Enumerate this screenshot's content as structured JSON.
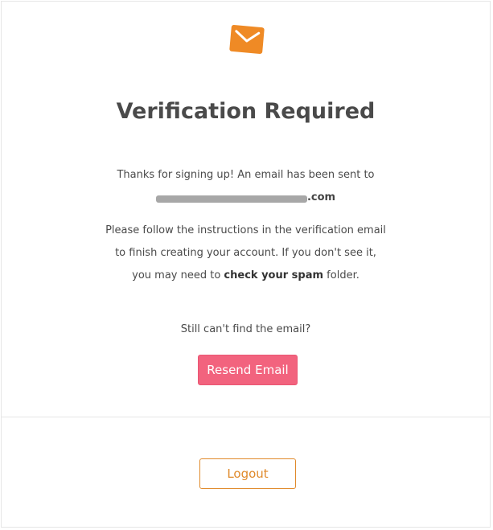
{
  "header": {
    "logo_icon": "mail-envelope-icon",
    "title": "Verification Required"
  },
  "message": {
    "sent_text": "Thanks for signing up! An email has been sent to",
    "email_suffix": ".com",
    "instructions_line1": "Please follow the instructions in the verification email",
    "instructions_line2": "to finish creating your account. If you don't see it,",
    "instructions_line3_prefix": "you may need to ",
    "instructions_line3_bold": "check your spam",
    "instructions_line3_suffix": " folder.",
    "still_cant_find": "Still can't find the email?"
  },
  "actions": {
    "resend_label": "Resend Email",
    "logout_label": "Logout"
  },
  "colors": {
    "accent_orange": "#e08a2b",
    "resend_pink": "#f2637e"
  }
}
